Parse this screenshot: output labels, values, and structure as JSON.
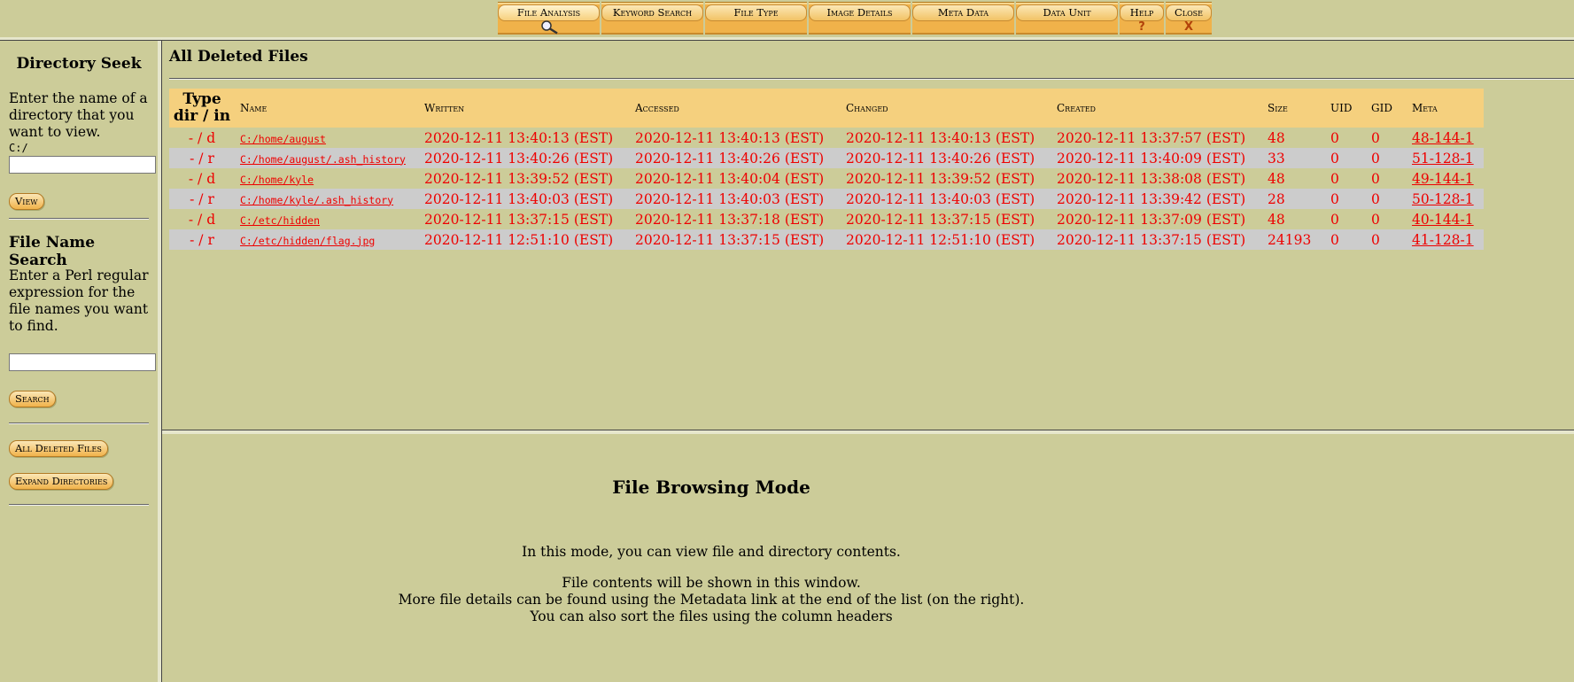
{
  "top_tabs": [
    {
      "label": "File Analysis",
      "sub": "search-icon"
    },
    {
      "label": "Keyword Search",
      "sub": ""
    },
    {
      "label": "File Type",
      "sub": ""
    },
    {
      "label": "Image Details",
      "sub": ""
    },
    {
      "label": "Meta Data",
      "sub": ""
    },
    {
      "label": "Data Unit",
      "sub": ""
    },
    {
      "label": "Help",
      "sub": "?"
    },
    {
      "label": "Close",
      "sub": "X"
    }
  ],
  "sidebar": {
    "dir_title": "Directory Seek",
    "dir_text": "Enter the name of a directory that you want to view.",
    "dir_prefix": "C:/",
    "dir_input_value": "",
    "view_button": "View",
    "search_title": "File Name Search",
    "search_text": "Enter a Perl regular expression for the file names you want to find.",
    "search_input_value": "",
    "search_button": "Search",
    "all_deleted_button": "All Deleted Files",
    "expand_button": "Expand Directories"
  },
  "list": {
    "heading": "All Deleted Files",
    "columns": {
      "type_line1": "Type",
      "type_line2": "dir / in",
      "name": "Name",
      "written": "Written",
      "accessed": "Accessed",
      "changed": "Changed",
      "created": "Created",
      "size": "Size",
      "uid": "UID",
      "gid": "GID",
      "meta": "Meta"
    },
    "rows": [
      {
        "type": "- / d",
        "name": "C:/home/august",
        "written": "2020-12-11 13:40:13 (EST)",
        "accessed": "2020-12-11 13:40:13 (EST)",
        "changed": "2020-12-11 13:40:13 (EST)",
        "created": "2020-12-11 13:37:57 (EST)",
        "size": "48",
        "uid": "0",
        "gid": "0",
        "meta": "48-144-1"
      },
      {
        "type": "- / r",
        "name": "C:/home/august/.ash_history",
        "written": "2020-12-11 13:40:26 (EST)",
        "accessed": "2020-12-11 13:40:26 (EST)",
        "changed": "2020-12-11 13:40:26 (EST)",
        "created": "2020-12-11 13:40:09 (EST)",
        "size": "33",
        "uid": "0",
        "gid": "0",
        "meta": "51-128-1"
      },
      {
        "type": "- / d",
        "name": "C:/home/kyle",
        "written": "2020-12-11 13:39:52 (EST)",
        "accessed": "2020-12-11 13:40:04 (EST)",
        "changed": "2020-12-11 13:39:52 (EST)",
        "created": "2020-12-11 13:38:08 (EST)",
        "size": "48",
        "uid": "0",
        "gid": "0",
        "meta": "49-144-1"
      },
      {
        "type": "- / r",
        "name": "C:/home/kyle/.ash_history",
        "written": "2020-12-11 13:40:03 (EST)",
        "accessed": "2020-12-11 13:40:03 (EST)",
        "changed": "2020-12-11 13:40:03 (EST)",
        "created": "2020-12-11 13:39:42 (EST)",
        "size": "28",
        "uid": "0",
        "gid": "0",
        "meta": "50-128-1"
      },
      {
        "type": "- / d",
        "name": "C:/etc/hidden",
        "written": "2020-12-11 13:37:15 (EST)",
        "accessed": "2020-12-11 13:37:18 (EST)",
        "changed": "2020-12-11 13:37:15 (EST)",
        "created": "2020-12-11 13:37:09 (EST)",
        "size": "48",
        "uid": "0",
        "gid": "0",
        "meta": "40-144-1"
      },
      {
        "type": "- / r",
        "name": "C:/etc/hidden/flag.jpg",
        "written": "2020-12-11 12:51:10 (EST)",
        "accessed": "2020-12-11 13:37:15 (EST)",
        "changed": "2020-12-11 12:51:10 (EST)",
        "created": "2020-12-11 13:37:15 (EST)",
        "size": "24193",
        "uid": "0",
        "gid": "0",
        "meta": "41-128-1"
      }
    ]
  },
  "content": {
    "title": "File Browsing Mode",
    "line1": "In this mode, you can view file and directory contents.",
    "line2": "File contents will be shown in this window.",
    "line3": "More file details can be found using the Metadata link at the end of the list (on the right).",
    "line4": "You can also sort the files using the column headers"
  },
  "colors": {
    "background": "#cccc99",
    "tab_orange": "#f0b24a",
    "header_yellow": "#f5d07e",
    "link_red": "#ee0000",
    "row_alt": "#cccccc"
  }
}
